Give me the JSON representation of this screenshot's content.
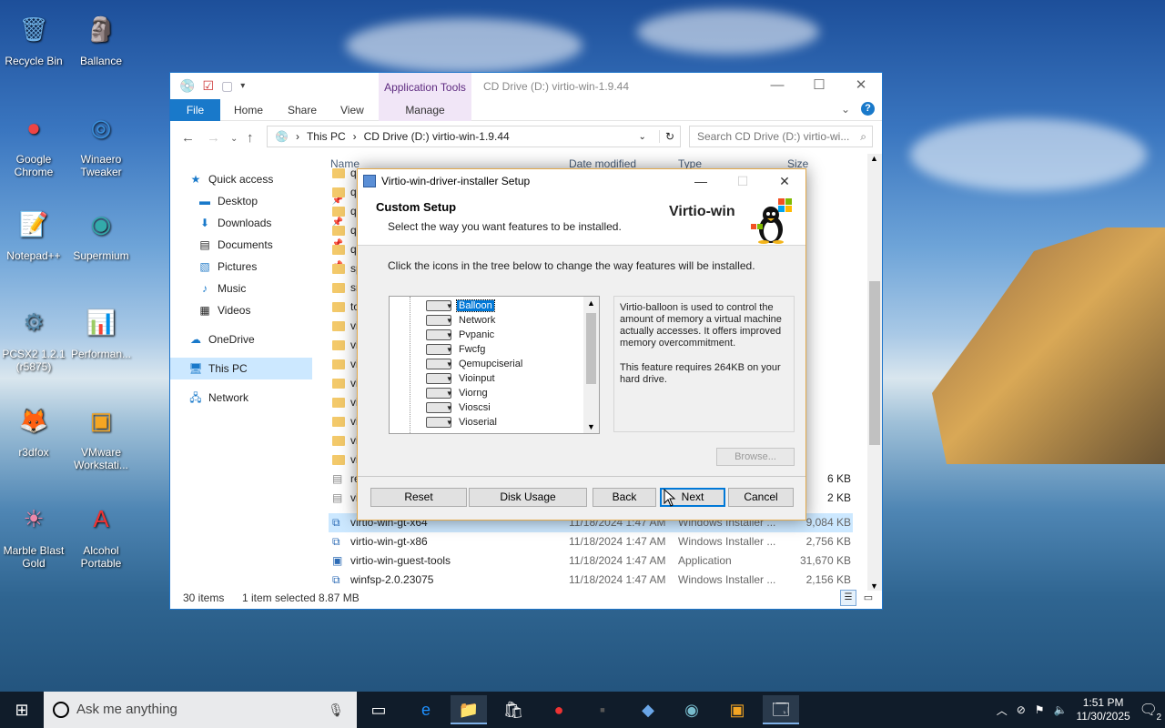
{
  "desktop": {
    "icons": [
      {
        "label": "Recycle Bin",
        "icon": "recycle-bin-icon",
        "glyph": "🗑"
      },
      {
        "label": "Ballance",
        "icon": "ballance-icon",
        "glyph": "🗿"
      },
      {
        "label": "Google Chrome",
        "icon": "chrome-icon",
        "glyph": "●"
      },
      {
        "label": "Winaero Tweaker",
        "icon": "winaero-icon",
        "glyph": "◎"
      },
      {
        "label": "Notepad++",
        "icon": "notepad-icon",
        "glyph": "📝"
      },
      {
        "label": "Supermium",
        "icon": "supermium-icon",
        "glyph": "◉"
      },
      {
        "label": "PCSX2 1.2.1 (r5875)",
        "icon": "pcsx2-icon",
        "glyph": "⚙"
      },
      {
        "label": "Performan...",
        "icon": "performance-icon",
        "glyph": "📊"
      },
      {
        "label": "r3dfox",
        "icon": "r3dfox-icon",
        "glyph": "🦊"
      },
      {
        "label": "VMware Workstati...",
        "icon": "vmware-icon",
        "glyph": "▣"
      },
      {
        "label": "Marble Blast Gold",
        "icon": "marble-blast-icon",
        "glyph": "☀"
      },
      {
        "label": "Alcohol Portable",
        "icon": "alcohol-icon",
        "glyph": "A"
      }
    ]
  },
  "explorer": {
    "app_tools": "Application Tools",
    "title": "CD Drive (D:) virtio-win-1.9.44",
    "ribbon_tabs": {
      "file": "File",
      "home": "Home",
      "share": "Share",
      "view": "View",
      "manage": "Manage"
    },
    "address": {
      "root": "This PC",
      "sep": "›",
      "current": "CD Drive (D:) virtio-win-1.9.44"
    },
    "search_placeholder": "Search CD Drive (D:) virtio-wi...",
    "nav": {
      "quick_access": "Quick access",
      "desktop": "Desktop",
      "downloads": "Downloads",
      "documents": "Documents",
      "pictures": "Pictures",
      "music": "Music",
      "videos": "Videos",
      "onedrive": "OneDrive",
      "this_pc": "This PC",
      "network": "Network"
    },
    "columns": {
      "name": "Name",
      "date": "Date modified",
      "type": "Type",
      "size": "Size"
    },
    "visible_name_stubs": [
      "q",
      "q",
      "q",
      "q",
      "q",
      "sp",
      "sr",
      "to",
      "vi",
      "vi",
      "vi",
      "vi",
      "vi",
      "vi",
      "vi",
      "vi",
      "re",
      "vi"
    ],
    "partial_sizes": [
      "6 KB",
      "2 KB"
    ],
    "rows": [
      {
        "name": "virtio-win-gt-x64",
        "date": "11/18/2024 1:47 AM",
        "type": "Windows Installer ...",
        "size": "9,084 KB"
      },
      {
        "name": "virtio-win-gt-x86",
        "date": "11/18/2024 1:47 AM",
        "type": "Windows Installer ...",
        "size": "2,756 KB"
      },
      {
        "name": "virtio-win-guest-tools",
        "date": "11/18/2024 1:47 AM",
        "type": "Application",
        "size": "31,670 KB"
      },
      {
        "name": "winfsp-2.0.23075",
        "date": "11/18/2024 1:47 AM",
        "type": "Windows Installer ...",
        "size": "2,156 KB"
      }
    ],
    "status": {
      "items": "30 items",
      "selected": "1 item selected  8.87 MB"
    }
  },
  "dialog": {
    "title": "Virtio-win-driver-installer Setup",
    "heading": "Custom Setup",
    "subheading": "Select the way you want features to be installed.",
    "brand": "Virtio-win",
    "instruction": "Click the icons in the tree below to change the way features will be installed.",
    "features": [
      "Balloon",
      "Network",
      "Pvpanic",
      "Fwcfg",
      "Qemupciserial",
      "Vioinput",
      "Viorng",
      "Vioscsi",
      "Vioserial"
    ],
    "selected_feature": "Balloon",
    "description": "Virtio-balloon is used to control the amount of memory a virtual machine actually accesses. It offers improved memory overcommitment.",
    "requirement": "This feature requires 264KB on your hard drive.",
    "buttons": {
      "browse": "Browse...",
      "reset": "Reset",
      "disk_usage": "Disk Usage",
      "back": "Back",
      "next": "Next",
      "cancel": "Cancel"
    }
  },
  "taskbar": {
    "search_placeholder": "Ask me anything",
    "time": "1:51 PM",
    "date": "11/30/2025",
    "notifications": "2"
  }
}
